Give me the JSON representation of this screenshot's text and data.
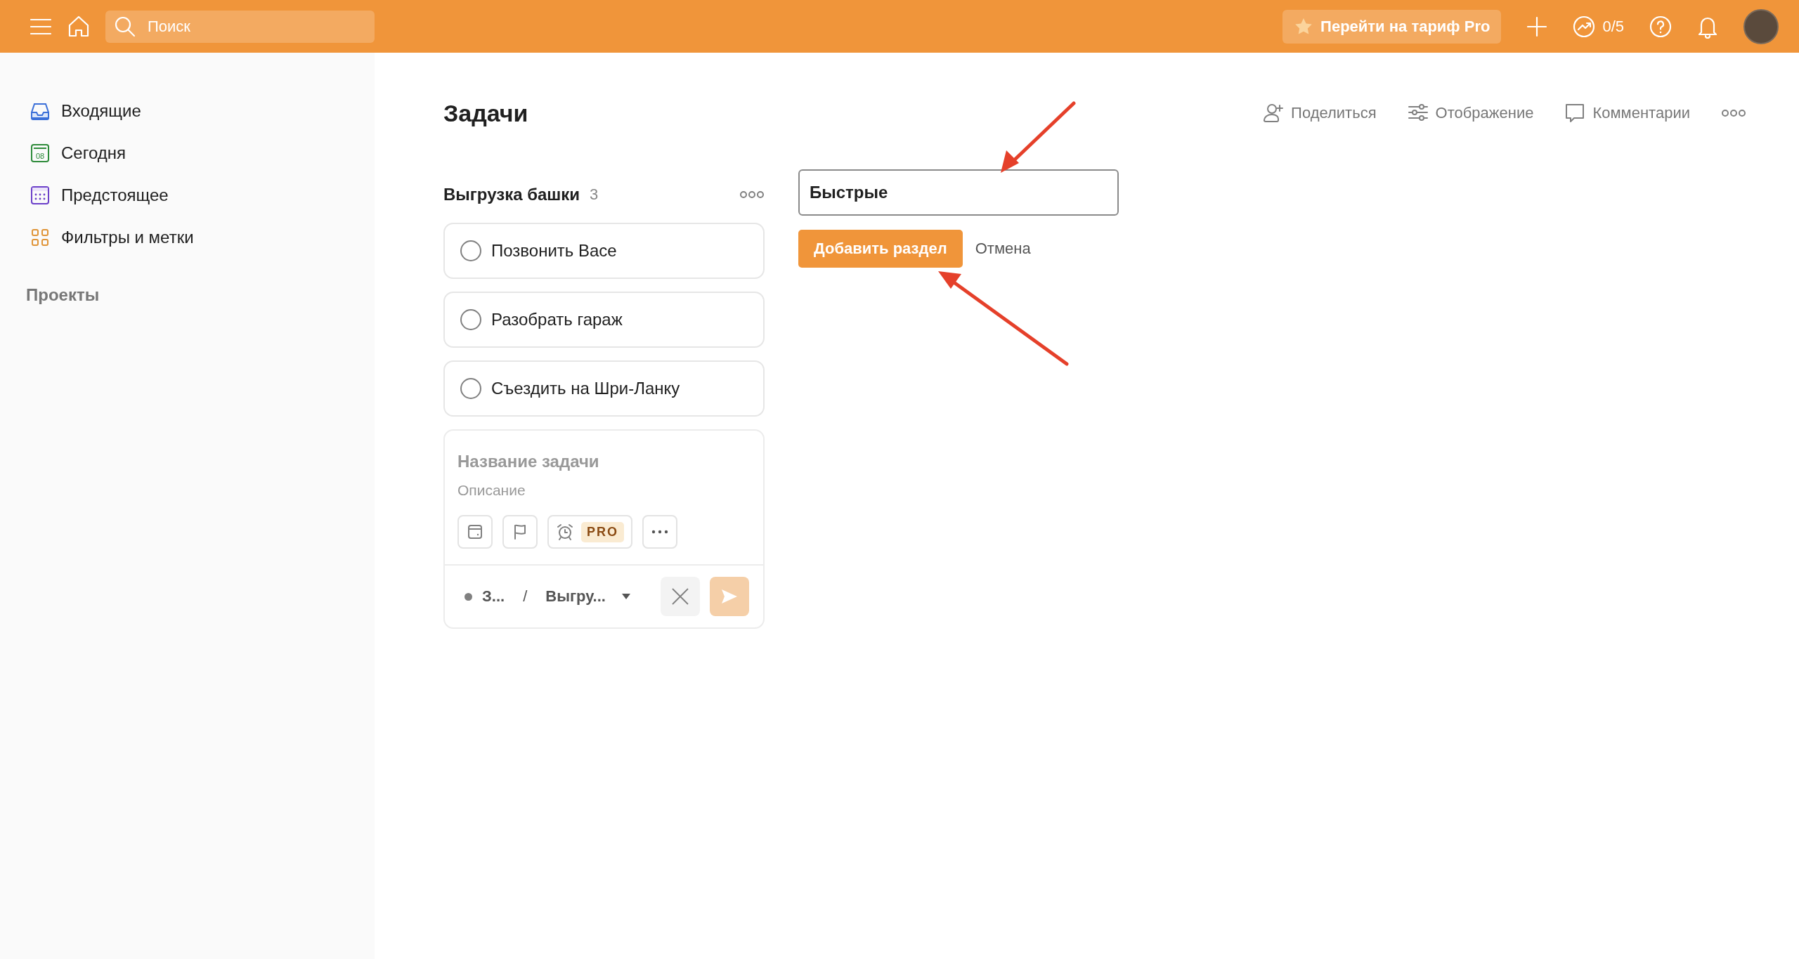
{
  "topbar": {
    "search": {
      "placeholder": "Поиск"
    },
    "upgrade_button": "Перейти на тариф Pro",
    "karma": "0/5"
  },
  "sidebar": {
    "items": [
      {
        "label": "Входящие",
        "kind": "inbox"
      },
      {
        "label": "Сегодня",
        "kind": "today",
        "icon_text": "08"
      },
      {
        "label": "Предстоящее",
        "kind": "upcoming"
      },
      {
        "label": "Фильтры и метки",
        "kind": "filters"
      }
    ],
    "section_title": "Проекты"
  },
  "project": {
    "title": "Задачи",
    "actions": [
      {
        "label": "Поделиться",
        "kind": "share"
      },
      {
        "label": "Отображение",
        "kind": "view"
      },
      {
        "label": "Комментарии",
        "kind": "comments"
      }
    ]
  },
  "section": {
    "title": "Выгрузка башки",
    "count": "3",
    "tasks": [
      {
        "title": "Позвонить Васе",
        "checked": false
      },
      {
        "title": "Разобрать гараж",
        "checked": false
      },
      {
        "title": "Съездить на Шри-Ланку",
        "checked": false
      }
    ]
  },
  "task_editor": {
    "name_placeholder": "Название задачи",
    "description_placeholder": "Описание",
    "pro_badge": "PRO",
    "project": "З...",
    "separator": "/",
    "section": "Выгру..."
  },
  "new_section": {
    "value": "Быстрые",
    "add_button": "Добавить раздел",
    "cancel_button": "Отмена"
  }
}
